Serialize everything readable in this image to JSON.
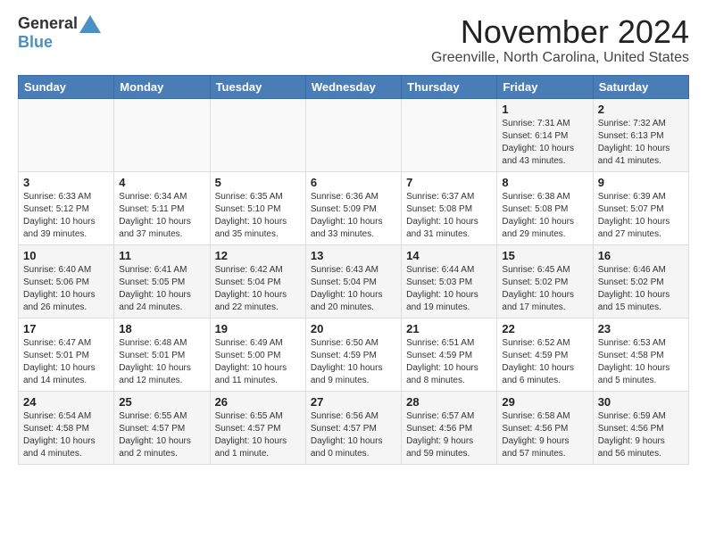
{
  "header": {
    "logo_general": "General",
    "logo_blue": "Blue",
    "month_title": "November 2024",
    "location": "Greenville, North Carolina, United States"
  },
  "weekdays": [
    "Sunday",
    "Monday",
    "Tuesday",
    "Wednesday",
    "Thursday",
    "Friday",
    "Saturday"
  ],
  "weeks": [
    [
      {
        "day": "",
        "info": ""
      },
      {
        "day": "",
        "info": ""
      },
      {
        "day": "",
        "info": ""
      },
      {
        "day": "",
        "info": ""
      },
      {
        "day": "",
        "info": ""
      },
      {
        "day": "1",
        "info": "Sunrise: 7:31 AM\nSunset: 6:14 PM\nDaylight: 10 hours\nand 43 minutes."
      },
      {
        "day": "2",
        "info": "Sunrise: 7:32 AM\nSunset: 6:13 PM\nDaylight: 10 hours\nand 41 minutes."
      }
    ],
    [
      {
        "day": "3",
        "info": "Sunrise: 6:33 AM\nSunset: 5:12 PM\nDaylight: 10 hours\nand 39 minutes."
      },
      {
        "day": "4",
        "info": "Sunrise: 6:34 AM\nSunset: 5:11 PM\nDaylight: 10 hours\nand 37 minutes."
      },
      {
        "day": "5",
        "info": "Sunrise: 6:35 AM\nSunset: 5:10 PM\nDaylight: 10 hours\nand 35 minutes."
      },
      {
        "day": "6",
        "info": "Sunrise: 6:36 AM\nSunset: 5:09 PM\nDaylight: 10 hours\nand 33 minutes."
      },
      {
        "day": "7",
        "info": "Sunrise: 6:37 AM\nSunset: 5:08 PM\nDaylight: 10 hours\nand 31 minutes."
      },
      {
        "day": "8",
        "info": "Sunrise: 6:38 AM\nSunset: 5:08 PM\nDaylight: 10 hours\nand 29 minutes."
      },
      {
        "day": "9",
        "info": "Sunrise: 6:39 AM\nSunset: 5:07 PM\nDaylight: 10 hours\nand 27 minutes."
      }
    ],
    [
      {
        "day": "10",
        "info": "Sunrise: 6:40 AM\nSunset: 5:06 PM\nDaylight: 10 hours\nand 26 minutes."
      },
      {
        "day": "11",
        "info": "Sunrise: 6:41 AM\nSunset: 5:05 PM\nDaylight: 10 hours\nand 24 minutes."
      },
      {
        "day": "12",
        "info": "Sunrise: 6:42 AM\nSunset: 5:04 PM\nDaylight: 10 hours\nand 22 minutes."
      },
      {
        "day": "13",
        "info": "Sunrise: 6:43 AM\nSunset: 5:04 PM\nDaylight: 10 hours\nand 20 minutes."
      },
      {
        "day": "14",
        "info": "Sunrise: 6:44 AM\nSunset: 5:03 PM\nDaylight: 10 hours\nand 19 minutes."
      },
      {
        "day": "15",
        "info": "Sunrise: 6:45 AM\nSunset: 5:02 PM\nDaylight: 10 hours\nand 17 minutes."
      },
      {
        "day": "16",
        "info": "Sunrise: 6:46 AM\nSunset: 5:02 PM\nDaylight: 10 hours\nand 15 minutes."
      }
    ],
    [
      {
        "day": "17",
        "info": "Sunrise: 6:47 AM\nSunset: 5:01 PM\nDaylight: 10 hours\nand 14 minutes."
      },
      {
        "day": "18",
        "info": "Sunrise: 6:48 AM\nSunset: 5:01 PM\nDaylight: 10 hours\nand 12 minutes."
      },
      {
        "day": "19",
        "info": "Sunrise: 6:49 AM\nSunset: 5:00 PM\nDaylight: 10 hours\nand 11 minutes."
      },
      {
        "day": "20",
        "info": "Sunrise: 6:50 AM\nSunset: 4:59 PM\nDaylight: 10 hours\nand 9 minutes."
      },
      {
        "day": "21",
        "info": "Sunrise: 6:51 AM\nSunset: 4:59 PM\nDaylight: 10 hours\nand 8 minutes."
      },
      {
        "day": "22",
        "info": "Sunrise: 6:52 AM\nSunset: 4:59 PM\nDaylight: 10 hours\nand 6 minutes."
      },
      {
        "day": "23",
        "info": "Sunrise: 6:53 AM\nSunset: 4:58 PM\nDaylight: 10 hours\nand 5 minutes."
      }
    ],
    [
      {
        "day": "24",
        "info": "Sunrise: 6:54 AM\nSunset: 4:58 PM\nDaylight: 10 hours\nand 4 minutes."
      },
      {
        "day": "25",
        "info": "Sunrise: 6:55 AM\nSunset: 4:57 PM\nDaylight: 10 hours\nand 2 minutes."
      },
      {
        "day": "26",
        "info": "Sunrise: 6:55 AM\nSunset: 4:57 PM\nDaylight: 10 hours\nand 1 minute."
      },
      {
        "day": "27",
        "info": "Sunrise: 6:56 AM\nSunset: 4:57 PM\nDaylight: 10 hours\nand 0 minutes."
      },
      {
        "day": "28",
        "info": "Sunrise: 6:57 AM\nSunset: 4:56 PM\nDaylight: 9 hours\nand 59 minutes."
      },
      {
        "day": "29",
        "info": "Sunrise: 6:58 AM\nSunset: 4:56 PM\nDaylight: 9 hours\nand 57 minutes."
      },
      {
        "day": "30",
        "info": "Sunrise: 6:59 AM\nSunset: 4:56 PM\nDaylight: 9 hours\nand 56 minutes."
      }
    ]
  ]
}
